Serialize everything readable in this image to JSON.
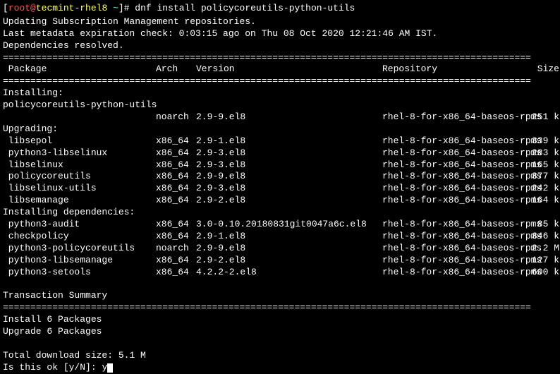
{
  "prompt": {
    "user": "root",
    "at": "@",
    "host": "tecmint-rhel8",
    "tilde": " ~",
    "hash": "]#",
    "command": "dnf install policycoreutils-python-utils"
  },
  "preoutput": {
    "line1": "Updating Subscription Management repositories.",
    "line2": "Last metadata expiration check: 0:03:15 ago on Thu 08 Oct 2020 12:21:46 AM IST.",
    "line3": "Dependencies resolved."
  },
  "divider": "================================================================================================",
  "table_header": {
    "pkg": " Package",
    "arch": "Arch",
    "ver": "Version",
    "repo": "Repository",
    "size": "Size"
  },
  "sections": {
    "installing": "Installing:",
    "upgrading": "Upgrading:",
    "installing_deps": "Installing dependencies:"
  },
  "installing": [
    {
      "pkg": " policycoreutils-python-utils",
      "arch": "noarch",
      "ver": "2.9-9.el8",
      "repo": "rhel-8-for-x86_64-baseos-rpms",
      "size": "251 k"
    }
  ],
  "upgrading": [
    {
      "pkg": " libsepol",
      "arch": "x86_64",
      "ver": "2.9-1.el8",
      "repo": "rhel-8-for-x86_64-baseos-rpms",
      "size": "339 k"
    },
    {
      "pkg": " python3-libselinux",
      "arch": "x86_64",
      "ver": "2.9-3.el8",
      "repo": "rhel-8-for-x86_64-baseos-rpms",
      "size": "283 k"
    },
    {
      "pkg": " libselinux",
      "arch": "x86_64",
      "ver": "2.9-3.el8",
      "repo": "rhel-8-for-x86_64-baseos-rpms",
      "size": "165 k"
    },
    {
      "pkg": " policycoreutils",
      "arch": "x86_64",
      "ver": "2.9-9.el8",
      "repo": "rhel-8-for-x86_64-baseos-rpms",
      "size": "377 k"
    },
    {
      "pkg": " libselinux-utils",
      "arch": "x86_64",
      "ver": "2.9-3.el8",
      "repo": "rhel-8-for-x86_64-baseos-rpms",
      "size": "242 k"
    },
    {
      "pkg": " libsemanage",
      "arch": "x86_64",
      "ver": "2.9-2.el8",
      "repo": "rhel-8-for-x86_64-baseos-rpms",
      "size": "164 k"
    }
  ],
  "installing_deps": [
    {
      "pkg": " python3-audit",
      "arch": "x86_64",
      "ver": "3.0-0.10.20180831git0047a6c.el8",
      "repo": "rhel-8-for-x86_64-baseos-rpms",
      "size": " 85 k"
    },
    {
      "pkg": " checkpolicy",
      "arch": "x86_64",
      "ver": "2.9-1.el8",
      "repo": "rhel-8-for-x86_64-baseos-rpms",
      "size": "346 k"
    },
    {
      "pkg": " python3-policycoreutils",
      "arch": "noarch",
      "ver": "2.9-9.el8",
      "repo": "rhel-8-for-x86_64-baseos-rpms",
      "size": "2.2 M"
    },
    {
      "pkg": " python3-libsemanage",
      "arch": "x86_64",
      "ver": "2.9-2.el8",
      "repo": "rhel-8-for-x86_64-baseos-rpms",
      "size": "127 k"
    },
    {
      "pkg": " python3-setools",
      "arch": "x86_64",
      "ver": "4.2.2-2.el8",
      "repo": "rhel-8-for-x86_64-baseos-rpms",
      "size": "600 k"
    }
  ],
  "summary": {
    "title": "Transaction Summary",
    "install": "Install  6 Packages",
    "upgrade": "Upgrade  6 Packages",
    "download": "Total download size: 5.1 M",
    "confirm": "Is this ok [y/N]: ",
    "input": "y"
  }
}
